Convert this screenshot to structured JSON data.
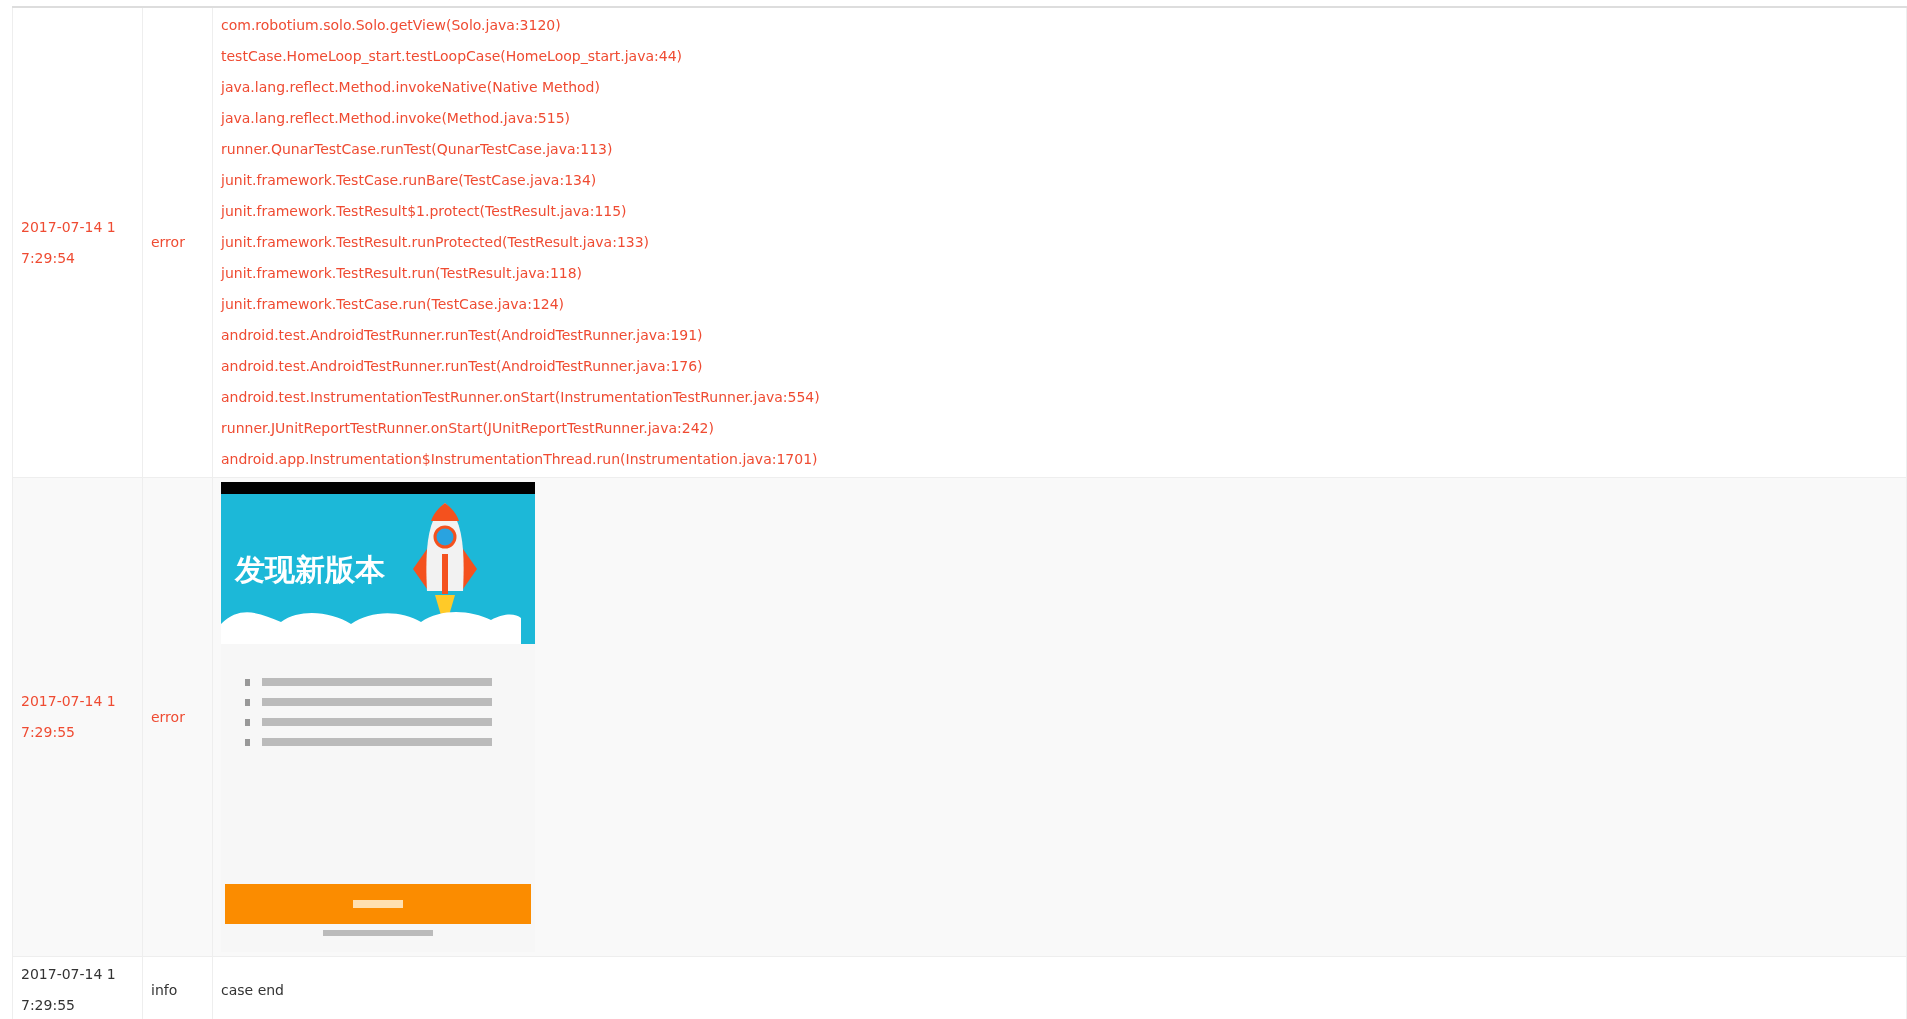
{
  "log_rows": [
    {
      "time": "2017-07-14 1 7:29:54",
      "level": "error",
      "kind": "trace",
      "lines": [
        "com.robotium.solo.Solo.getView(Solo.java:3120)",
        "testCase.HomeLoop_start.testLoopCase(HomeLoop_start.java:44)",
        "java.lang.reflect.Method.invokeNative(Native Method)",
        "java.lang.reflect.Method.invoke(Method.java:515)",
        "runner.QunarTestCase.runTest(QunarTestCase.java:113)",
        "junit.framework.TestCase.runBare(TestCase.java:134)",
        "junit.framework.TestResult$1.protect(TestResult.java:115)",
        "junit.framework.TestResult.runProtected(TestResult.java:133)",
        "junit.framework.TestResult.run(TestResult.java:118)",
        "junit.framework.TestCase.run(TestCase.java:124)",
        "android.test.AndroidTestRunner.runTest(AndroidTestRunner.java:191)",
        "android.test.AndroidTestRunner.runTest(AndroidTestRunner.java:176)",
        "android.test.InstrumentationTestRunner.onStart(InstrumentationTestRunner.java:554)",
        "runner.JUnitReportTestRunner.onStart(JUnitReportTestRunner.java:242)",
        "android.app.Instrumentation$InstrumentationThread.run(Instrumentation.java:1701)"
      ]
    },
    {
      "time": "2017-07-14 1 7:29:55",
      "level": "error",
      "kind": "screenshot",
      "screenshot": {
        "banner_title": "发现新版本"
      }
    },
    {
      "time": "2017-07-14 1 7:29:55",
      "level": "info",
      "kind": "text",
      "message": "case end"
    }
  ]
}
